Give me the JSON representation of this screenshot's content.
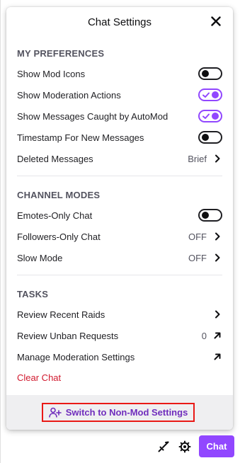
{
  "panel": {
    "title": "Chat Settings"
  },
  "sections": {
    "preferences": {
      "title": "MY PREFERENCES",
      "items": [
        {
          "label": "Show Mod Icons",
          "toggle": false
        },
        {
          "label": "Show Moderation Actions",
          "toggle": true
        },
        {
          "label": "Show Messages Caught by AutoMod",
          "toggle": true
        },
        {
          "label": "Timestamp For New Messages",
          "toggle": false
        },
        {
          "label": "Deleted Messages",
          "value": "Brief"
        }
      ]
    },
    "channel_modes": {
      "title": "CHANNEL MODES",
      "items": [
        {
          "label": "Emotes-Only Chat",
          "toggle": false
        },
        {
          "label": "Followers-Only Chat",
          "value": "OFF"
        },
        {
          "label": "Slow Mode",
          "value": "OFF"
        }
      ]
    },
    "tasks": {
      "title": "TASKS",
      "items": [
        {
          "label": "Review Recent Raids"
        },
        {
          "label": "Review Unban Requests",
          "value": "0"
        },
        {
          "label": "Manage Moderation Settings"
        },
        {
          "label": "Clear Chat"
        }
      ]
    }
  },
  "footer": {
    "switch_label": "Switch to Non-Mod Settings"
  },
  "bottom_bar": {
    "chat_label": "Chat"
  },
  "colors": {
    "accent": "#9147ff",
    "danger": "#d1192e",
    "highlight_border": "#e91916"
  }
}
